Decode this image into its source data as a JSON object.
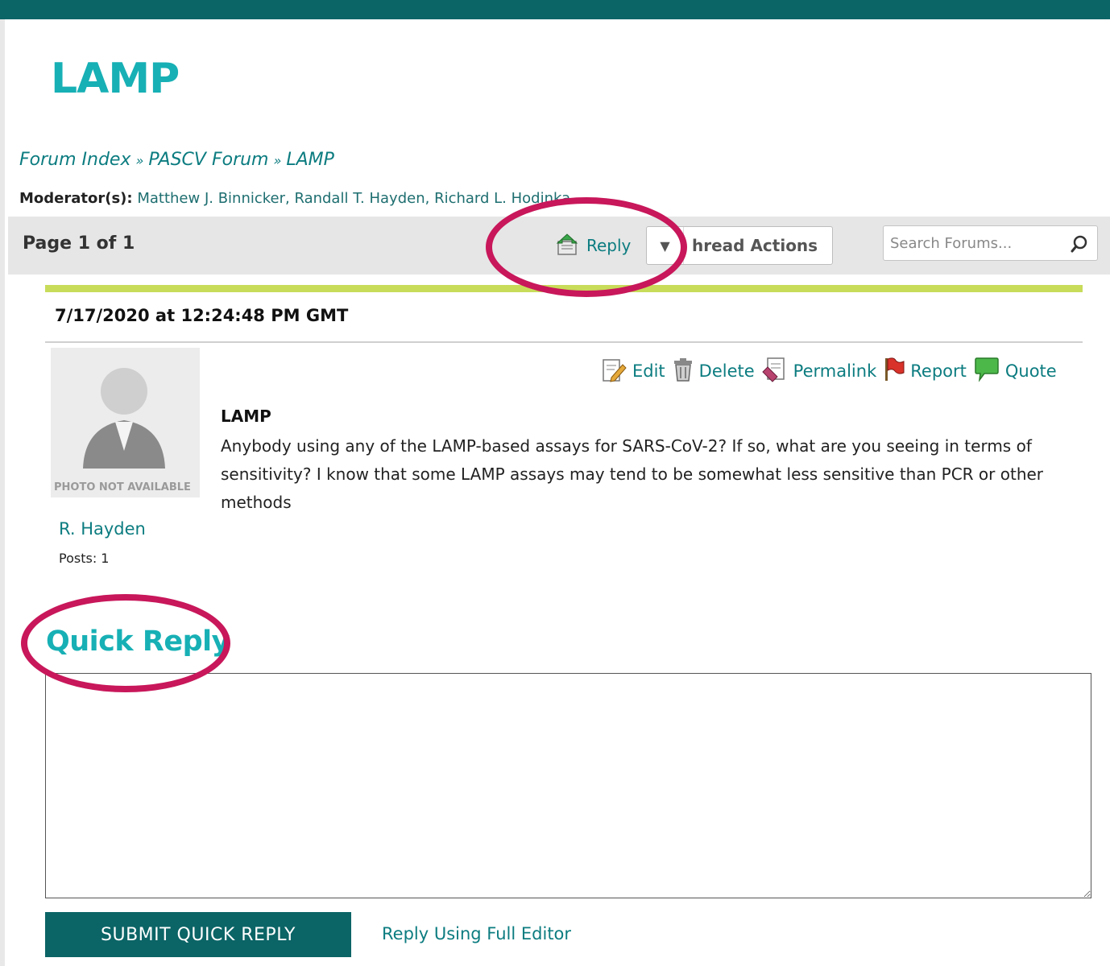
{
  "page": {
    "title": "LAMP"
  },
  "breadcrumb": {
    "items": [
      "Forum Index",
      "PASCV Forum",
      "LAMP"
    ],
    "separator": "»"
  },
  "moderators": {
    "label": "Moderator(s):",
    "names": "Matthew J. Binnicker, Randall T. Hayden, Richard L. Hodinka"
  },
  "toolbar": {
    "page_info": "Page 1 of 1",
    "reply_label": "Reply",
    "thread_actions_label": "hread Actions",
    "search_placeholder": "Search Forums..."
  },
  "post": {
    "date": "7/17/2020 at 12:24:48 PM GMT",
    "avatar_note": "PHOTO NOT AVAILABLE",
    "author": "R. Hayden",
    "posts_count": "Posts: 1",
    "actions": {
      "edit": "Edit",
      "delete": "Delete",
      "permalink": "Permalink",
      "report": "Report",
      "quote": "Quote"
    },
    "title": "LAMP",
    "body": "Anybody using any of the LAMP-based assays for SARS-CoV-2? If so, what are you seeing in terms of sensitivity? I know that some LAMP assays may tend to be somewhat less sensitive than PCR or other methods"
  },
  "quick_reply": {
    "title": "Quick Reply",
    "textarea_value": "",
    "submit_label": "SUBMIT QUICK REPLY",
    "full_editor_label": "Reply Using Full Editor"
  },
  "colors": {
    "header_bar": "#0b6466",
    "title_teal": "#17b0b5",
    "link_teal": "#0c7c80",
    "post_accent": "#c8dc5a",
    "annotation": "#c8175a"
  }
}
